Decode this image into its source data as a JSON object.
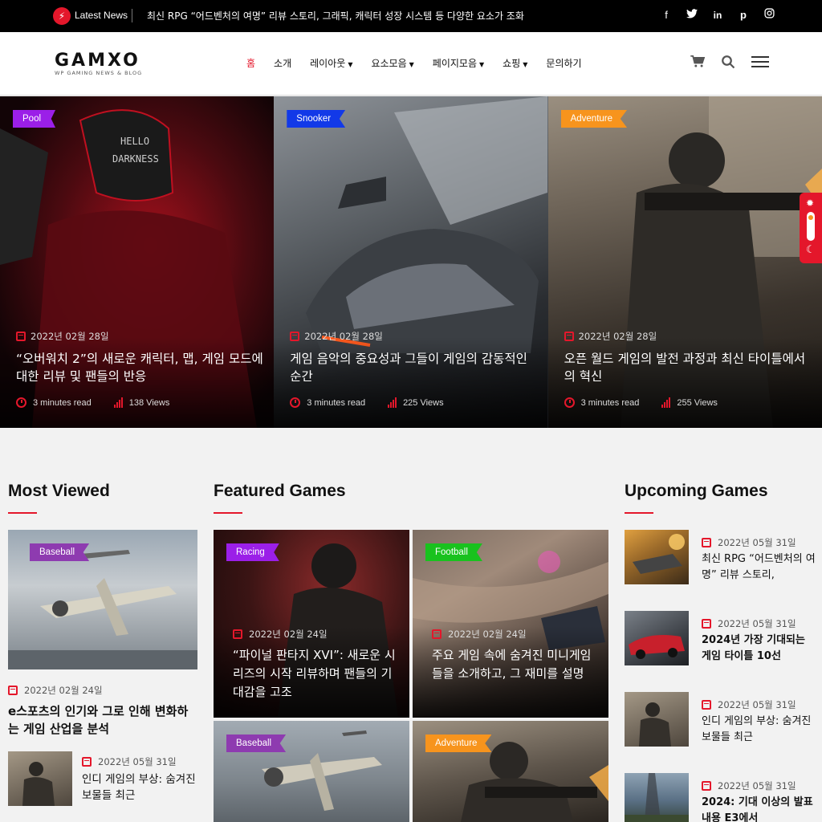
{
  "topbar": {
    "latest_label": "Latest News",
    "news": "최신 RPG “어드벤처의 여명” 리뷰 스토리, 그래픽, 캐릭터 성장 시스템 등 다양한 요소가 조화",
    "social_icons": [
      "facebook-icon",
      "twitter-icon",
      "linkedin-icon",
      "pinterest-icon",
      "instagram-icon"
    ]
  },
  "header": {
    "logo": "GAMXO",
    "logo_sub": "WP GAMING NEWS & BLOG",
    "nav": [
      "홈",
      "소개",
      "레이아웃",
      "요소모음",
      "페이지모음",
      "쇼핑",
      "문의하기"
    ]
  },
  "hero": [
    {
      "tag": "Pool",
      "date": "2022년 02월 28일",
      "title": "“오버워치 2”의 새로운 캐릭터, 맵, 게임 모드에 대한 리뷰 및 팬들의 반응",
      "read": "3 minutes read",
      "views": "138 Views"
    },
    {
      "tag": "Snooker",
      "date": "2022년 02월 28일",
      "title": "게임 음악의 중요성과 그들이 게임의 감동적인 순간",
      "read": "3 minutes read",
      "views": "225 Views"
    },
    {
      "tag": "Adventure",
      "date": "2022년 02월 28일",
      "title": "오픈 월드 게임의 발전 과정과 최신 타이틀에서의 혁신",
      "read": "3 minutes read",
      "views": "255 Views"
    }
  ],
  "most_viewed": {
    "title": "Most Viewed",
    "main": {
      "tag": "Baseball",
      "date": "2022년 02월 24일",
      "title": "e스포츠의 인기와 그로 인해 변화하는 게임 산업을 분석"
    },
    "small": {
      "date": "2022년 05월 31일",
      "title": "인디 게임의 부상: 숨겨진 보물들 최근"
    }
  },
  "featured": {
    "title": "Featured Games",
    "cards": [
      {
        "tag": "Racing",
        "date": "2022년 02월 24일",
        "title": "“파이널 판타지 XVI”: 새로운 시리즈의 시작 리뷰하며 팬들의 기대감을 고조"
      },
      {
        "tag": "Football",
        "date": "2022년 02월 24일",
        "title": "주요 게임 속에 숨겨진 미니게임들을 소개하고, 그 재미를 설명"
      },
      {
        "tag": "Baseball"
      },
      {
        "tag": "Adventure"
      }
    ]
  },
  "upcoming": {
    "title": "Upcoming Games",
    "items": [
      {
        "date": "2022년 05월 31일",
        "title": "최신 RPG “어드벤처의 여명” 리뷰 스토리,"
      },
      {
        "date": "2022년 05월 31일",
        "title": "2024년 가장 기대되는 게임 타이틀 10선"
      },
      {
        "date": "2022년 05월 31일",
        "title": "인디 게임의 부상: 숨겨진 보물들 최근"
      },
      {
        "date": "2022년 05월 31일",
        "title": "2024: 기대 이상의 발표 내용 E3에서"
      }
    ]
  },
  "colors": {
    "accent": "#e4172b",
    "tag_purple": "#9b1fe8",
    "tag_blue": "#1239e8",
    "tag_orange": "#f7941d",
    "tag_green": "#19c21e",
    "tag_violet": "#8e3bb0"
  }
}
